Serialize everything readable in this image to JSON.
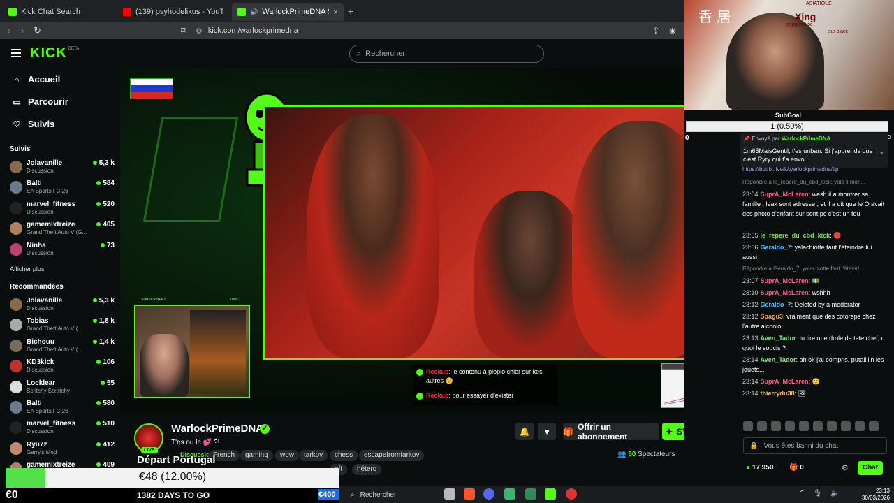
{
  "browser": {
    "tabs": [
      {
        "label": "Kick Chat Search",
        "favicon_color": "#53fc18",
        "active": false
      },
      {
        "label": "(139) psyhodelikus - YouTube",
        "favicon_color": "#ff0000",
        "active": false
      },
      {
        "label": "WarlockPrimeDNA Stream - W",
        "favicon_color": "#53fc18",
        "active": true
      }
    ],
    "tab_close": "×",
    "new_tab": "+",
    "url": "kick.com/warlockprimedna"
  },
  "kick": {
    "logo": "KICK",
    "logo_beta": "BETA",
    "search_placeholder": "Rechercher"
  },
  "sidebar": {
    "nav": [
      {
        "label": "Accueil",
        "icon": "home-icon"
      },
      {
        "label": "Parcourir",
        "icon": "browse-icon"
      },
      {
        "label": "Suivis",
        "icon": "heart-icon"
      }
    ],
    "followed_title": "Suivis",
    "followed": [
      {
        "name": "Jolavanille",
        "category": "Discussion",
        "viewers": "5,3 k",
        "color": "#8a6a4a"
      },
      {
        "name": "Balti",
        "category": "EA Sports FC 26",
        "viewers": "584",
        "color": "#6a7a8a"
      },
      {
        "name": "marvel_fitness",
        "category": "Discussion",
        "viewers": "520",
        "color": "#222222"
      },
      {
        "name": "gamemixtreize",
        "category": "Grand Theft Auto V (G...",
        "viewers": "405",
        "color": "#b08060"
      },
      {
        "name": "Ninha",
        "category": "Discussion",
        "viewers": "73",
        "color": "#c04070"
      }
    ],
    "show_more": "Afficher plus",
    "recommended_title": "Recommandées",
    "recommended": [
      {
        "name": "Jolavanille",
        "category": "Discussion",
        "viewers": "5,3 k",
        "color": "#8a6a4a"
      },
      {
        "name": "Tobias",
        "category": "Grand Theft Auto V (...",
        "viewers": "1,8 k",
        "color": "#aaaaaa"
      },
      {
        "name": "Bichouu",
        "category": "Grand Theft Auto V (...",
        "viewers": "1,4 k",
        "color": "#7a6a5a"
      },
      {
        "name": "KD3kick",
        "category": "Discussion",
        "viewers": "106",
        "color": "#c03030"
      },
      {
        "name": "Locklear",
        "category": "Scritchy Scratchy",
        "viewers": "55",
        "color": "#dddddd"
      },
      {
        "name": "Balti",
        "category": "EA Sports FC 26",
        "viewers": "580",
        "color": "#6a7a8a"
      },
      {
        "name": "marvel_fitness",
        "category": "Discussion",
        "viewers": "510",
        "color": "#222222"
      },
      {
        "name": "Ryu7z",
        "category": "Garry's Mod",
        "viewers": "412",
        "color": "#c08a70"
      },
      {
        "name": "gamemixtreize",
        "category": "",
        "viewers": "409",
        "color": "#b08060"
      }
    ]
  },
  "video": {
    "overlay_chat": [
      {
        "user": "Reckup",
        "text": "le contenu à piopio chier sur kes autres 😊"
      },
      {
        "user": "Reckup",
        "text": "pour essayer d'exister"
      }
    ],
    "webcam_bar_labels": [
      "SUBSCRIBERS",
      "1000"
    ],
    "live_badge": "LIVE"
  },
  "stream": {
    "streamer": "WarlockPrimeDNA",
    "title": "T'es ou le 💕 ?!",
    "category": "Discussion",
    "tags": [
      "French",
      "gaming",
      "wow",
      "tarkov",
      "chess",
      "escapefromtarkov",
      "hétero",
      "aft"
    ],
    "gift_label": "Offrir un abonnement",
    "subscribe_label": "S'abonner",
    "viewers_count": "50",
    "viewers_label": "Spectateurs"
  },
  "overlay": {
    "depart": "Départ Portugal",
    "goal_text": "€48 (12.00%)",
    "goal_fraction": 0.12,
    "money_left": "€0",
    "money_right": "€400",
    "days": "1382 DAYS TO GO"
  },
  "cam2": {
    "sign_chinese": "香 居",
    "sign_top": "ASIATIQUE",
    "sign_xing": "Xing",
    "sign_sub": "et japonaise",
    "sign_bottom": "sur place"
  },
  "chat": {
    "subgoal_label": "SubGoal",
    "subgoal_value": "1 (0.50%)",
    "subgoal_fraction": 0.005,
    "subgoal_min": "0",
    "subgoal_max": "200",
    "pinned_by_label": "Envoyé par",
    "pinned_by": "WarlockPrimeDNA",
    "pinned_text": "1m65MaisGentil, t'es unban. Si j'apprends que c'est Ryry qui t'a envo...",
    "pinned_link": "https://botrix.live/k/warlockprimedna/tip",
    "messages": [
      {
        "reply": "Répondre à le_repere_du_cbd_kick: yala il mon..."
      },
      {
        "time": "23:04",
        "user": "SuprA_McLaren",
        "color": "#ff5c8a",
        "text": "wesh il a montrer sa famille , leak sont adresse , et il a dit que le O avait des photo d'enfant sur sont pc c'est un fou"
      },
      {
        "time": "23:05",
        "user": "le_repere_du_cbd_kick",
        "color": "#53fc18",
        "text": "🔴"
      },
      {
        "time": "23:06",
        "user": "Geraldo_7",
        "color": "#4fc3f7",
        "text": "yalachiotte faut l'éteindre lui aussi"
      },
      {
        "reply": "Répondre à Geraldo_7: yalachiotte faut l'éteind..."
      },
      {
        "time": "23:07",
        "user": "SuprA_McLaren",
        "color": "#ff5c8a",
        "text": "💵"
      },
      {
        "time": "23:10",
        "user": "SuprA_McLaren",
        "color": "#ff5c8a",
        "text": "wshhh"
      },
      {
        "time": "23:12",
        "user": "Geraldo_7",
        "color": "#4fc3f7",
        "text": "Deleted by a moderator"
      },
      {
        "time": "23:12",
        "user": "Spagu3",
        "color": "#ff9f43",
        "text": "vraiment que des cotoreps chez l'autre alcoolo"
      },
      {
        "time": "23:13",
        "user": "Aven_Tador",
        "color": "#7cf07c",
        "text": "tu tire une drole de tete chef, c quoi le soucis ?"
      },
      {
        "time": "23:14",
        "user": "Aven_Tador",
        "color": "#7cf07c",
        "text": "ah ok j'ai compris, putaiiiiin les jouets..."
      },
      {
        "time": "23:14",
        "user": "SuprA_McLaren",
        "color": "#ff5c8a",
        "text": "🙂"
      },
      {
        "time": "23:14",
        "user": "thierrydu38",
        "color": "#ffb74d",
        "text": "🖼"
      }
    ],
    "input_placeholder": "Vous êtes banni du chat",
    "points": "17 950",
    "gifts": "0",
    "send_label": "Chat"
  },
  "taskbar": {
    "search_label": "Rechercher",
    "time": "23:13",
    "date": "30/03/2026"
  }
}
